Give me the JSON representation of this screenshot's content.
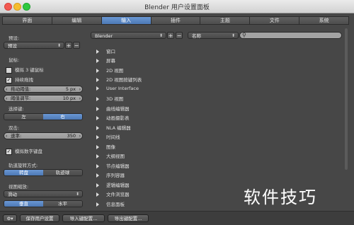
{
  "window": {
    "title": "Blender 用户设置面板"
  },
  "tabs": [
    "界面",
    "编辑",
    "输入",
    "插件",
    "主题",
    "文件",
    "系统"
  ],
  "active_tab": "输入",
  "left": {
    "preset_label": "预设:",
    "preset_value": "预设",
    "plus": "+",
    "minus": "−",
    "mouse_label": "鼠标:",
    "emulate_3button": "模拟 3 键鼠标",
    "continuous_grab": "持续拖拽",
    "drag_threshold_label": "拖动阈值:",
    "drag_threshold_value": "5 px",
    "select_threshold_label": "阈值调节:",
    "select_threshold_value": "10 px",
    "select_with_label": "选择键:",
    "select_left": "左",
    "select_right": "右",
    "double_click_label": "双击:",
    "speed_label": "速率:",
    "speed_value": "350",
    "emulate_numpad": "模拟数字键盘",
    "orbit_style_label": "轨道旋转方式:",
    "orbit_turntable": "转盘",
    "orbit_trackball": "轨迹球",
    "zoom_label": "视图缩放:",
    "zoom_value": "滑动",
    "zoom_vertical": "垂直",
    "zoom_horizontal": "水平"
  },
  "right": {
    "keymap_preset": "Blender",
    "search_mode": "名称",
    "items": [
      "窗口",
      "屏幕",
      "2D 视图",
      "2D 视图按键列表",
      "User Interface",
      "3D 视图",
      "曲线编辑器",
      "动画摄影表",
      "NLA 编辑器",
      "时间线",
      "图像",
      "大纲视图",
      "节点编辑器",
      "序列容器",
      "逻辑编辑器",
      "文件浏览器",
      "信息面板"
    ]
  },
  "bottom": {
    "save_button": "保存用户设置",
    "import_button": "导入键配置...",
    "export_button": "导出键配置..."
  },
  "watermark": "软件技巧"
}
